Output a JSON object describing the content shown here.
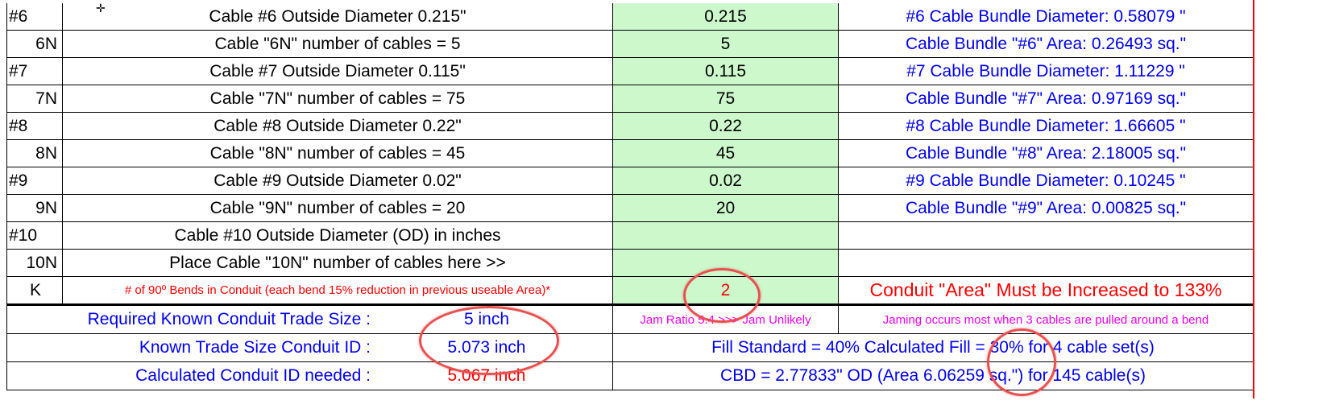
{
  "cable_rows": [
    {
      "id": "#6",
      "label": "Cable #6 Outside Diameter 0.215\"",
      "value": "0.215",
      "result": "#6 Cable Bundle Diameter: 0.58079 \""
    },
    {
      "id": "6N",
      "label": "Cable \"6N\" number of cables = 5",
      "value": "5",
      "result": "Cable Bundle \"#6\" Area: 0.26493 sq.\""
    },
    {
      "id": "#7",
      "label": "Cable #7 Outside Diameter 0.115\"",
      "value": "0.115",
      "result": "#7 Cable Bundle Diameter: 1.11229 \""
    },
    {
      "id": "7N",
      "label": "Cable \"7N\" number of cables = 75",
      "value": "75",
      "result": "Cable Bundle \"#7\" Area: 0.97169 sq.\""
    },
    {
      "id": "#8",
      "label": "Cable #8 Outside Diameter 0.22\"",
      "value": "0.22",
      "result": "#8 Cable Bundle Diameter: 1.66605 \""
    },
    {
      "id": "8N",
      "label": "Cable \"8N\" number of cables = 45",
      "value": "45",
      "result": "Cable Bundle \"#8\" Area: 2.18005 sq.\""
    },
    {
      "id": "#9",
      "label": "Cable #9 Outside Diameter 0.02\"",
      "value": "0.02",
      "result": "#9 Cable Bundle Diameter: 0.10245 \""
    },
    {
      "id": "9N",
      "label": "Cable \"9N\" number of cables = 20",
      "value": "20",
      "result": "Cable Bundle \"#9\" Area: 0.00825 sq.\""
    },
    {
      "id": "#10",
      "label": "Cable #10 Outside Diameter (OD) in inches",
      "value": "",
      "result": ""
    },
    {
      "id": "10N",
      "label": "Place Cable \"10N\" number of cables here >>",
      "value": "",
      "result": ""
    }
  ],
  "bends": {
    "id": "K",
    "label": "# of 90º Bends in Conduit (each bend 15% reduction in previous useable Area)*",
    "value": "2",
    "result": "Conduit \"Area\" Must be Increased to 133%"
  },
  "summary": {
    "trade_size_label": "Required Known Conduit Trade Size :",
    "trade_size_value": "5 inch",
    "jam_ratio": "Jam Ratio 5.4 >>> Jam Unlikely",
    "jam_note": "Jaming occurs most when 3 cables are pulled around a bend",
    "known_id_label": "Known Trade Size Conduit ID :",
    "known_id_value": "5.073 inch",
    "fill": "Fill Standard = 40% Calculated Fill = 30% for 4 cable set(s)",
    "calc_id_label": "Calculated Conduit ID needed :",
    "calc_id_value": "5.067 inch",
    "cbd": "CBD = 2.77833\" OD (Area 6.06259 sq.\") for 145 cable(s)"
  },
  "colors": {
    "input_fill": "#ccf8cc",
    "result_text": "#0000ee",
    "warning": "#ff0000",
    "note": "#ee00ee",
    "annotation_ring": "#e85050"
  }
}
